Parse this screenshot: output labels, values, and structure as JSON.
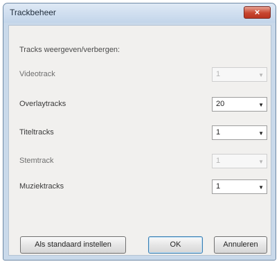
{
  "window": {
    "title": "Trackbeheer",
    "close_label": "×"
  },
  "section_heading": "Tracks weergeven/verbergen:",
  "rows": [
    {
      "label": "Videotrack",
      "value": "1",
      "enabled": false
    },
    {
      "label": "Overlaytracks",
      "value": "20",
      "enabled": true
    },
    {
      "label": "Titeltracks",
      "value": "1",
      "enabled": true
    },
    {
      "label": "Stemtrack",
      "value": "1",
      "enabled": false
    },
    {
      "label": "Muziektracks",
      "value": "1",
      "enabled": true
    }
  ],
  "buttons": {
    "default": "Als standaard instellen",
    "ok": "OK",
    "cancel": "Annuleren"
  },
  "icons": {
    "dropdown_arrow": "▼"
  }
}
